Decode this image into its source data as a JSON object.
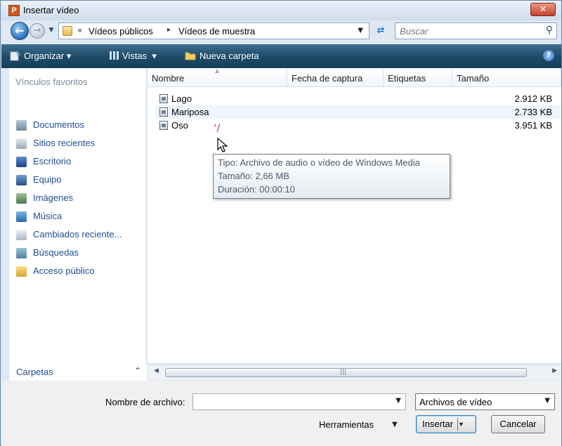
{
  "window": {
    "title": "Insertar vídeo",
    "app_icon_letter": "P",
    "close_glyph": "✕"
  },
  "address": {
    "prefix": "«",
    "breadcrumbs": [
      "Vídeos públicos",
      "Vídeos de muestra"
    ],
    "separator": "▸"
  },
  "search": {
    "placeholder": "Buscar"
  },
  "toolbar": {
    "organize_label": "Organizar",
    "views_label": "Vistas",
    "new_folder_label": "Nueva carpeta"
  },
  "sidebar": {
    "heading": "Vínculos favoritos",
    "items": [
      {
        "label": "Documentos",
        "icon": "documents-icon"
      },
      {
        "label": "Sitios recientes",
        "icon": "recent-places-icon"
      },
      {
        "label": "Escritorio",
        "icon": "desktop-icon"
      },
      {
        "label": "Equipo",
        "icon": "computer-icon"
      },
      {
        "label": "Imágenes",
        "icon": "pictures-icon"
      },
      {
        "label": "Música",
        "icon": "music-icon"
      },
      {
        "label": "Cambiados reciente...",
        "icon": "recently-changed-icon"
      },
      {
        "label": "Búsquedas",
        "icon": "searches-icon"
      },
      {
        "label": "Acceso público",
        "icon": "public-folder-icon"
      }
    ],
    "folders_label": "Carpetas"
  },
  "file_list": {
    "columns": [
      "Nombre",
      "Fecha de captura",
      "Etiquetas",
      "Tamaño"
    ],
    "rows": [
      {
        "name": "Lago",
        "size": "2.912 KB"
      },
      {
        "name": "Mariposa",
        "size": "2.733 KB"
      },
      {
        "name": "Oso",
        "size": "3.951 KB"
      }
    ]
  },
  "tooltip": {
    "type": "Tipo: Archivo de audio o vídeo de Windows Media",
    "size": "Tamaño: 2,66 MB",
    "duration": "Duración: 00:00:10"
  },
  "bottom": {
    "filename_label": "Nombre de archivo:",
    "filename_value": "",
    "file_type": "Archivos de vídeo",
    "tools_label": "Herramientas",
    "insert_label": "Insertar",
    "cancel_label": "Cancelar"
  },
  "colors": {
    "toolbar": "#1d4a66",
    "link": "#1f4e93",
    "close": "#c4422a"
  }
}
